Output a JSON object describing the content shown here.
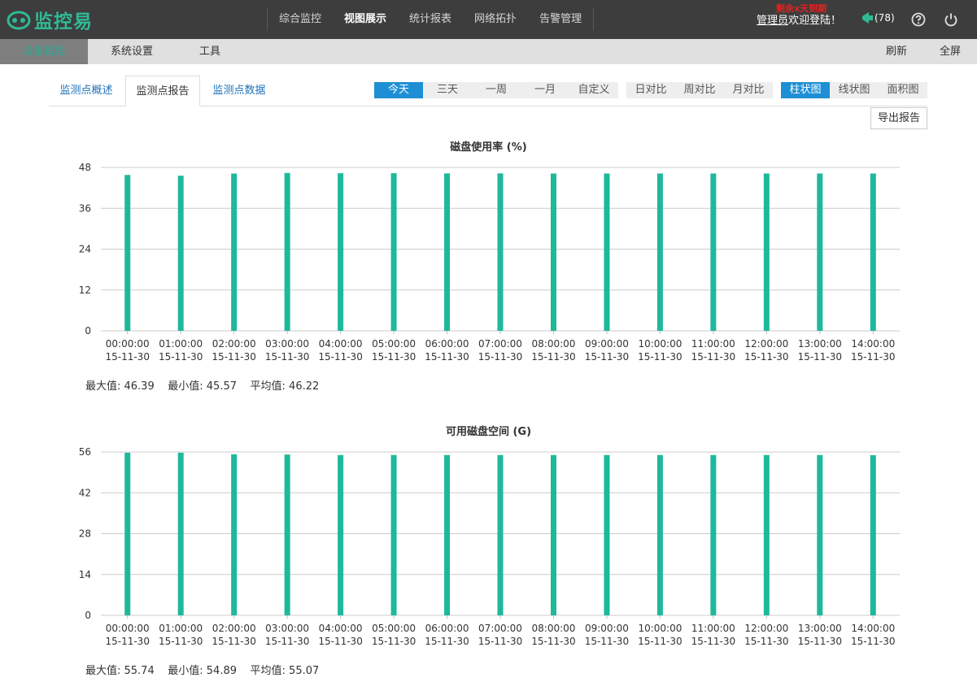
{
  "app": {
    "logo_text": "监控易"
  },
  "main_nav": [
    {
      "label": "综合监控",
      "active": false
    },
    {
      "label": "视图展示",
      "active": true
    },
    {
      "label": "统计报表",
      "active": false
    },
    {
      "label": "网络拓扑",
      "active": false
    },
    {
      "label": "告警管理",
      "active": false
    }
  ],
  "user": {
    "name": "管理员",
    "welcome": "欢迎登陆！",
    "expire_notice": "剩余x天到期"
  },
  "notifications": {
    "count_label": "(78)"
  },
  "icons": {
    "help": "help-circle-icon",
    "power": "power-icon",
    "notify": "megaphone-icon"
  },
  "sub_nav": {
    "items": [
      {
        "label": "设备管理",
        "active": true
      },
      {
        "label": "系统设置",
        "active": false
      },
      {
        "label": "工具",
        "active": false
      }
    ],
    "refresh": "刷新",
    "fullscreen": "全屏"
  },
  "tabs": [
    {
      "label": "监测点概述",
      "active": false
    },
    {
      "label": "监测点报告",
      "active": true
    },
    {
      "label": "监测点数据",
      "active": false
    }
  ],
  "time_range": [
    {
      "label": "今天",
      "active": true
    },
    {
      "label": "三天",
      "active": false
    },
    {
      "label": "一周",
      "active": false
    },
    {
      "label": "一月",
      "active": false
    },
    {
      "label": "自定义",
      "active": false
    }
  ],
  "compare": [
    {
      "label": "日对比"
    },
    {
      "label": "周对比"
    },
    {
      "label": "月对比"
    }
  ],
  "chart_types": [
    {
      "label": "柱状图",
      "active": true
    },
    {
      "label": "线状图",
      "active": false
    },
    {
      "label": "面积图",
      "active": false
    }
  ],
  "export_label": "导出报告",
  "colors": {
    "bar": "#1db99a",
    "accent": "#1e8fd4",
    "topbar": "#3d3d3d"
  },
  "chart_data": [
    {
      "type": "bar",
      "title": "磁盘使用率 (%)",
      "categories": [
        [
          "00:00:00",
          "15-11-30"
        ],
        [
          "01:00:00",
          "15-11-30"
        ],
        [
          "02:00:00",
          "15-11-30"
        ],
        [
          "03:00:00",
          "15-11-30"
        ],
        [
          "04:00:00",
          "15-11-30"
        ],
        [
          "05:00:00",
          "15-11-30"
        ],
        [
          "06:00:00",
          "15-11-30"
        ],
        [
          "07:00:00",
          "15-11-30"
        ],
        [
          "08:00:00",
          "15-11-30"
        ],
        [
          "09:00:00",
          "15-11-30"
        ],
        [
          "10:00:00",
          "15-11-30"
        ],
        [
          "11:00:00",
          "15-11-30"
        ],
        [
          "12:00:00",
          "15-11-30"
        ],
        [
          "13:00:00",
          "15-11-30"
        ],
        [
          "14:00:00",
          "15-11-30"
        ]
      ],
      "values": [
        45.8,
        45.57,
        46.2,
        46.39,
        46.3,
        46.3,
        46.25,
        46.25,
        46.22,
        46.22,
        46.22,
        46.22,
        46.22,
        46.22,
        46.22
      ],
      "ylim": [
        0,
        48
      ],
      "yticks": [
        0,
        12,
        24,
        36,
        48
      ],
      "grid": true,
      "stats": {
        "max_label": "最大值: 46.39",
        "min_label": "最小值: 45.57",
        "avg_label": "平均值: 46.22"
      }
    },
    {
      "type": "bar",
      "title": "可用磁盘空间 (G)",
      "categories": [
        [
          "00:00:00",
          "15-11-30"
        ],
        [
          "01:00:00",
          "15-11-30"
        ],
        [
          "02:00:00",
          "15-11-30"
        ],
        [
          "03:00:00",
          "15-11-30"
        ],
        [
          "04:00:00",
          "15-11-30"
        ],
        [
          "05:00:00",
          "15-11-30"
        ],
        [
          "06:00:00",
          "15-11-30"
        ],
        [
          "07:00:00",
          "15-11-30"
        ],
        [
          "08:00:00",
          "15-11-30"
        ],
        [
          "09:00:00",
          "15-11-30"
        ],
        [
          "10:00:00",
          "15-11-30"
        ],
        [
          "11:00:00",
          "15-11-30"
        ],
        [
          "12:00:00",
          "15-11-30"
        ],
        [
          "13:00:00",
          "15-11-30"
        ],
        [
          "14:00:00",
          "15-11-30"
        ]
      ],
      "values": [
        55.74,
        55.74,
        55.2,
        55.1,
        54.95,
        54.95,
        54.95,
        54.95,
        54.95,
        54.95,
        54.95,
        54.95,
        54.95,
        54.95,
        54.89
      ],
      "ylim": [
        0,
        56
      ],
      "yticks": [
        0,
        14,
        28,
        42,
        56
      ],
      "grid": true,
      "stats": {
        "max_label": "最大值: 55.74",
        "min_label": "最小值: 54.89",
        "avg_label": "平均值: 55.07"
      }
    }
  ]
}
